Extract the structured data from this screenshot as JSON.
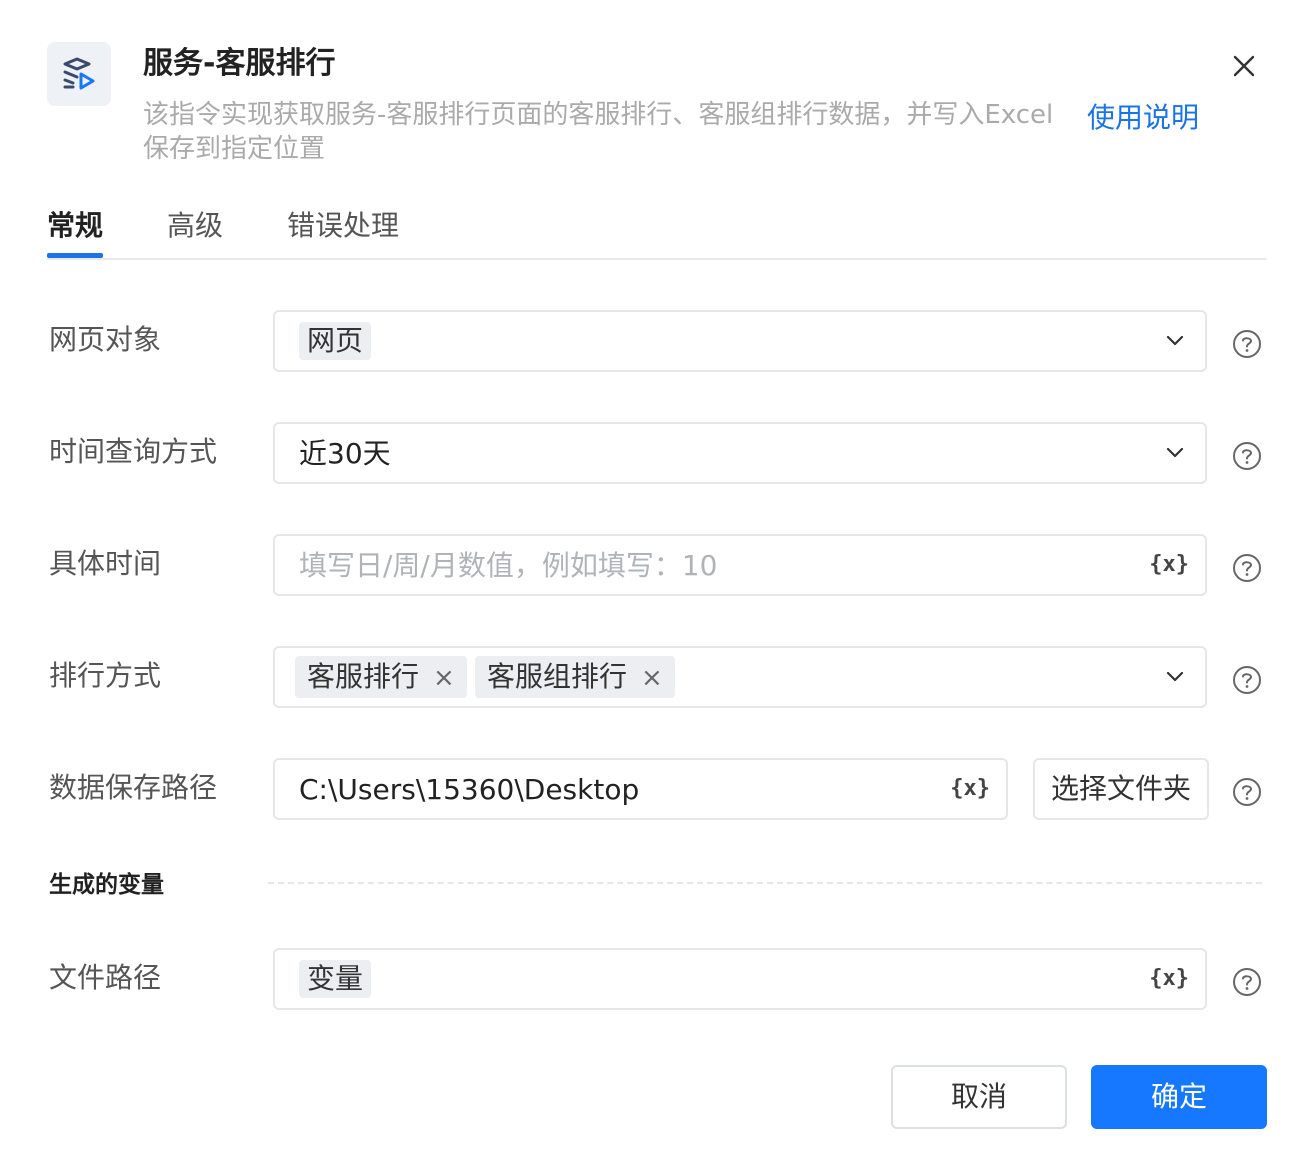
{
  "header": {
    "icon": "service-rank-icon",
    "title": "服务-客服排行",
    "description": "该指令实现获取服务-客服排行页面的客服排行、客服组排行数据，并写入Excel保存到指定位置",
    "help_link": "使用说明",
    "close_icon": "close-icon"
  },
  "tabs": [
    {
      "label": "常规",
      "active": true
    },
    {
      "label": "高级",
      "active": false
    },
    {
      "label": "错误处理",
      "active": false
    }
  ],
  "fields": {
    "web_object": {
      "label": "网页对象",
      "value": "网页"
    },
    "time_query": {
      "label": "时间查询方式",
      "value": "近30天"
    },
    "specific_time": {
      "label": "具体时间",
      "placeholder": "填写日/周/月数值，例如填写：10",
      "var_button": "{x}"
    },
    "rank_mode": {
      "label": "排行方式",
      "tags": [
        "客服排行",
        "客服组排行"
      ],
      "tag_close": "×"
    },
    "save_path": {
      "label": "数据保存路径",
      "value": "C:\\Users\\15360\\Desktop",
      "var_button": "{x}",
      "choose_button": "选择文件夹"
    }
  },
  "generated_variables": {
    "section_title": "生成的变量",
    "file_path": {
      "label": "文件路径",
      "value": "变量",
      "var_button": "{x}"
    }
  },
  "footer": {
    "cancel": "取消",
    "confirm": "确定"
  },
  "colors": {
    "accent": "#1677ff",
    "link": "#1a73e8"
  }
}
